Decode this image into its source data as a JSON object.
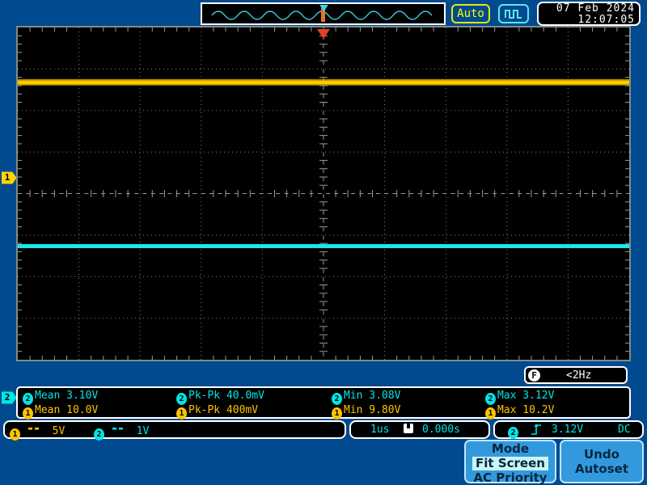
{
  "topbar": {
    "thumbnail": {
      "icon": "sine-wave-preview",
      "wave_color": "#35d6e8",
      "marker_color": "#e8731c"
    },
    "auto_button": {
      "label": "Auto",
      "color": "#ffff00"
    },
    "pulse_button": {
      "icon": "square-pulse-icon",
      "color": "#5ee7e7"
    },
    "clock": {
      "date": "07 Feb 2024",
      "time": "12:07:05"
    }
  },
  "display": {
    "trigger_marker": {
      "icon": "trigger-position-marker",
      "color": "#e8401c"
    },
    "ch1_marker": {
      "label": "1",
      "color": "#ffd400"
    },
    "ch2_marker": {
      "label": "2",
      "color": "#00e5e5"
    },
    "ch1_trace_color": "#ffc800",
    "ch2_trace_color": "#19e8e8",
    "grid_color": "#808080",
    "background": "#000000",
    "freq_counter": {
      "badge": "F",
      "value": "<2Hz"
    }
  },
  "measurements": {
    "row1": [
      {
        "channel": "2",
        "name": "Mean",
        "value": "3.10V",
        "text": "Mean 3.10V"
      },
      {
        "channel": "2",
        "name": "Pk-Pk",
        "value": "40.0mV",
        "text": "Pk-Pk 40.0mV"
      },
      {
        "channel": "2",
        "name": "Min",
        "value": "3.08V",
        "text": "Min 3.08V"
      },
      {
        "channel": "2",
        "name": "Max",
        "value": "3.12V",
        "text": "Max 3.12V"
      }
    ],
    "row2": [
      {
        "channel": "1",
        "name": "Mean",
        "value": "10.0V",
        "text": "Mean 10.0V"
      },
      {
        "channel": "1",
        "name": "Pk-Pk",
        "value": "400mV",
        "text": "Pk-Pk 400mV"
      },
      {
        "channel": "1",
        "name": "Min",
        "value": "9.80V",
        "text": "Min 9.80V"
      },
      {
        "channel": "1",
        "name": "Max",
        "value": "10.2V",
        "text": "Max 10.2V"
      }
    ]
  },
  "status": {
    "channels": [
      {
        "number": "1",
        "coupling_icon": "dc-coupling-icon",
        "scale": "5V",
        "color": "#ffc400"
      },
      {
        "number": "2",
        "coupling_icon": "dc-coupling-icon",
        "scale": "1V",
        "color": "#00e5e5"
      }
    ],
    "timebase": {
      "scale": "1us",
      "icon": "horizontal-position-icon",
      "delay": "0.000s"
    },
    "trigger": {
      "source": "2",
      "edge_icon": "rising-edge-icon",
      "level": "3.12V",
      "coupling": "DC"
    }
  },
  "softkeys": {
    "mode": {
      "title": "Mode",
      "selected": "Fit Screen",
      "option": "AC Priority"
    },
    "undo": {
      "line1": "Undo",
      "line2": "Autoset"
    }
  }
}
